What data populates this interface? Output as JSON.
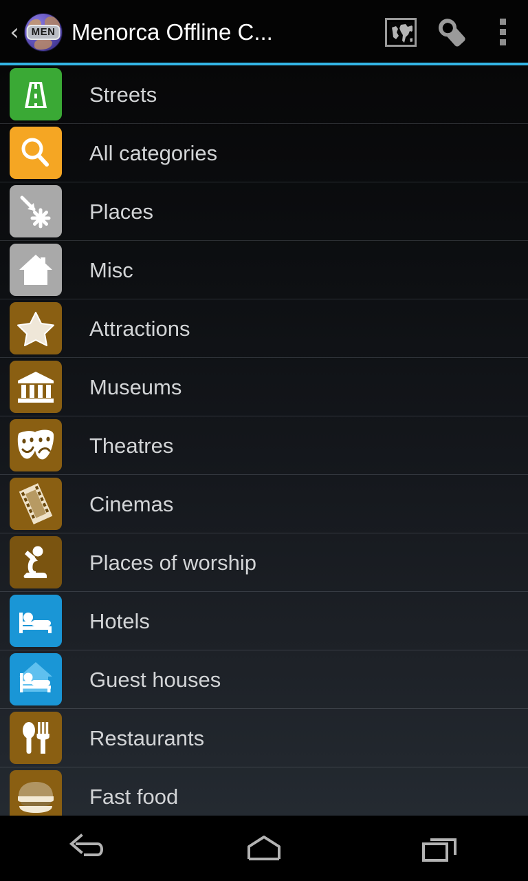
{
  "app": {
    "title": "Menorca Offline C...",
    "icon_badge": "MEN",
    "icon_name": "app-globe-icon",
    "accent_color": "#33b5e5"
  },
  "actionbar": {
    "back_label": "‹",
    "actions": [
      {
        "name": "world-map-icon",
        "label": "Map"
      },
      {
        "name": "wrench-icon",
        "label": "Tools"
      },
      {
        "name": "overflow-menu-icon",
        "label": "More options"
      }
    ]
  },
  "list": {
    "items": [
      {
        "label": "Streets",
        "icon": "road-icon",
        "color": "#3aa935"
      },
      {
        "label": "All categories",
        "icon": "magnifier-icon",
        "color": "#f5a623"
      },
      {
        "label": "Places",
        "icon": "arrow-burst-icon",
        "color": "#a9a9a9"
      },
      {
        "label": "Misc",
        "icon": "house-icon",
        "color": "#a9a9a9"
      },
      {
        "label": "Attractions",
        "icon": "star-icon",
        "color": "#8a5f12"
      },
      {
        "label": "Museums",
        "icon": "museum-icon",
        "color": "#8a5f12"
      },
      {
        "label": "Theatres",
        "icon": "masks-icon",
        "color": "#8a5f12"
      },
      {
        "label": "Cinemas",
        "icon": "filmstrip-icon",
        "color": "#8a5f12"
      },
      {
        "label": "Places of worship",
        "icon": "praying-icon",
        "color": "#7a5410"
      },
      {
        "label": "Hotels",
        "icon": "bed-icon",
        "color": "#1a96d6"
      },
      {
        "label": "Guest houses",
        "icon": "bed-house-icon",
        "color": "#1a96d6"
      },
      {
        "label": "Restaurants",
        "icon": "cutlery-icon",
        "color": "#8a5f12"
      },
      {
        "label": "Fast food",
        "icon": "burger-icon",
        "color": "#8a5f12"
      }
    ]
  },
  "navbar": {
    "buttons": [
      {
        "name": "nav-back-button",
        "label": "Back"
      },
      {
        "name": "nav-home-button",
        "label": "Home"
      },
      {
        "name": "nav-recents-button",
        "label": "Recent apps"
      }
    ]
  }
}
